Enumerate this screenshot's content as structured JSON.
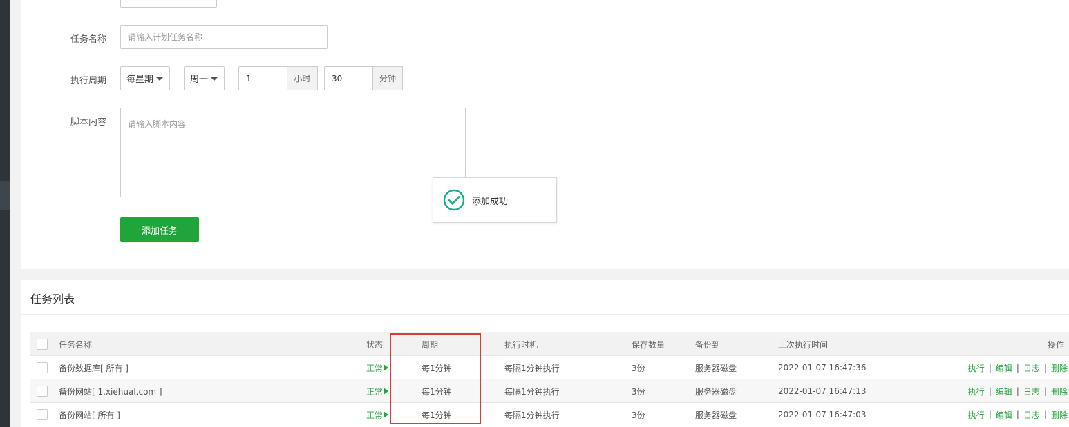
{
  "form": {
    "task_name_label": "任务名称",
    "task_name_placeholder": "请输入计划任务名称",
    "cycle_label": "执行周期",
    "cycle_type": "每星期",
    "weekday": "周一",
    "hour_value": "1",
    "hour_unit": "小时",
    "minute_value": "30",
    "minute_unit": "分钟",
    "script_label": "脚本内容",
    "script_placeholder": "请输入脚本内容",
    "add_button": "添加任务"
  },
  "toast": {
    "message": "添加成功"
  },
  "task_list": {
    "title": "任务列表",
    "columns": [
      "任务名称",
      "状态",
      "周期",
      "执行时机",
      "保存数量",
      "备份到",
      "上次执行时间",
      "操作"
    ],
    "actions": [
      "执行",
      "编辑",
      "日志",
      "删除"
    ],
    "rows": [
      {
        "name": "备份数据库[ 所有 ]",
        "status": "正常",
        "cycle": "每1分钟",
        "timing": "每隔1分钟执行",
        "keep": "3份",
        "backup_to": "服务器磁盘",
        "last_run": "2022-01-07 16:47:36"
      },
      {
        "name": "备份网站[ 1.xiehual.com ]",
        "status": "正常",
        "cycle": "每1分钟",
        "timing": "每隔1分钟执行",
        "keep": "3份",
        "backup_to": "服务器磁盘",
        "last_run": "2022-01-07 16:47:13"
      },
      {
        "name": "备份网站[ 所有 ]",
        "status": "正常",
        "cycle": "每1分钟",
        "timing": "每隔1分钟执行",
        "keep": "3份",
        "backup_to": "服务器磁盘",
        "last_run": "2022-01-07 16:47:03"
      }
    ]
  },
  "colors": {
    "accent": "#20a53a",
    "highlight": "#d93a3a",
    "toast_check": "#1aaa8e"
  }
}
